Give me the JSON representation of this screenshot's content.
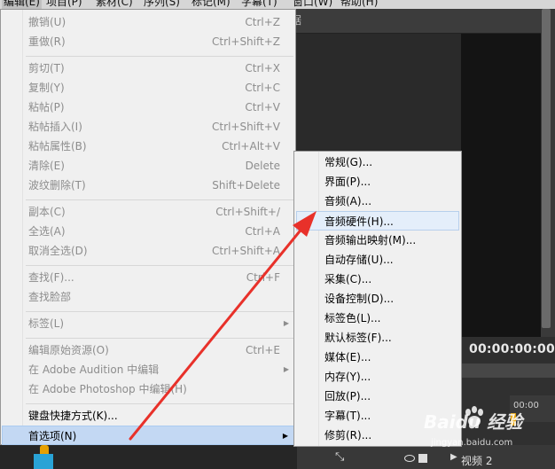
{
  "menubar": {
    "items": [
      "编辑(E)",
      "项目(P)",
      "素材(C)",
      "序列(S)",
      "标记(M)",
      "字幕(T)",
      "窗口(W)",
      "帮助(H)"
    ]
  },
  "background": {
    "panel_tab": "据",
    "timecode": "00:00:00:00",
    "timeline_time": "00:00",
    "track_label": "视频 2"
  },
  "edit_menu": {
    "items": [
      {
        "label": "撤销(U)",
        "shortcut": "Ctrl+Z"
      },
      {
        "label": "重做(R)",
        "shortcut": "Ctrl+Shift+Z"
      },
      {
        "label": "剪切(T)",
        "shortcut": "Ctrl+X"
      },
      {
        "label": "复制(Y)",
        "shortcut": "Ctrl+C"
      },
      {
        "label": "粘帖(P)",
        "shortcut": "Ctrl+V"
      },
      {
        "label": "粘帖插入(I)",
        "shortcut": "Ctrl+Shift+V"
      },
      {
        "label": "粘帖属性(B)",
        "shortcut": "Ctrl+Alt+V"
      },
      {
        "label": "清除(E)",
        "shortcut": "Delete"
      },
      {
        "label": "波纹删除(T)",
        "shortcut": "Shift+Delete"
      },
      {
        "label": "副本(C)",
        "shortcut": "Ctrl+Shift+/"
      },
      {
        "label": "全选(A)",
        "shortcut": "Ctrl+A"
      },
      {
        "label": "取消全选(D)",
        "shortcut": "Ctrl+Shift+A"
      },
      {
        "label": "查找(F)...",
        "shortcut": "Ctrl+F"
      },
      {
        "label": "查找脸部",
        "shortcut": ""
      },
      {
        "label": "标签(L)",
        "shortcut": ""
      },
      {
        "label": "编辑原始资源(O)",
        "shortcut": "Ctrl+E"
      },
      {
        "label": "在 Adobe Audition 中编辑",
        "shortcut": ""
      },
      {
        "label": "在 Adobe Photoshop 中编辑(H)",
        "shortcut": ""
      },
      {
        "label": "键盘快捷方式(K)...",
        "shortcut": ""
      },
      {
        "label": "首选项(N)",
        "shortcut": ""
      }
    ]
  },
  "preferences_submenu": {
    "items": [
      "常规(G)...",
      "界面(P)...",
      "音频(A)...",
      "音频硬件(H)...",
      "音频输出映射(M)...",
      "自动存储(U)...",
      "采集(C)...",
      "设备控制(D)...",
      "标签色(L)...",
      "默认标签(F)...",
      "媒体(E)...",
      "内存(Y)...",
      "回放(P)...",
      "字幕(T)...",
      "修剪(R)..."
    ]
  },
  "watermark": {
    "brand": "Baidu 经验",
    "url": "jingyan.baidu.com"
  },
  "colors": {
    "arrow": "#e8312a",
    "highlight": "#c3d8f3",
    "accent_clip": "#29a3d6",
    "playhead": "#e6a000"
  }
}
